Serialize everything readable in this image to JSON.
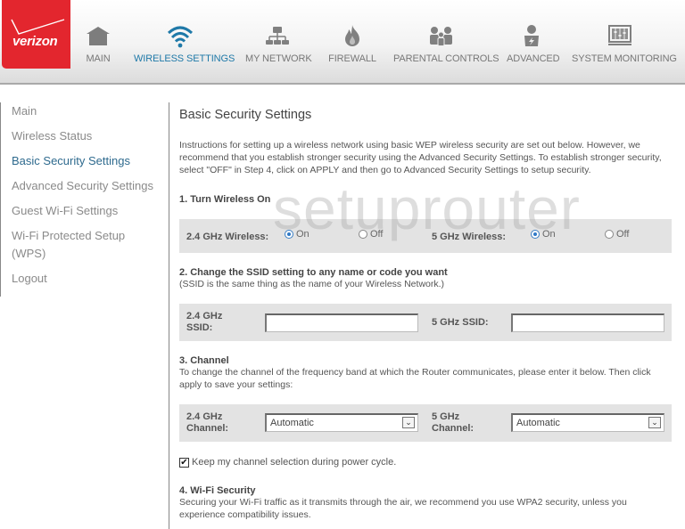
{
  "brand": {
    "logo_text": "verizon",
    "color": "#e3262e",
    "accent": "#1f79a8"
  },
  "nav": {
    "items": [
      {
        "label": "MAIN",
        "icon": "home-icon",
        "active": false
      },
      {
        "label": "WIRELESS SETTINGS",
        "icon": "wifi-icon",
        "active": true
      },
      {
        "label": "MY NETWORK",
        "icon": "network-icon",
        "active": false
      },
      {
        "label": "FIREWALL",
        "icon": "flame-icon",
        "active": false
      },
      {
        "label": "PARENTAL CONTROLS",
        "icon": "family-icon",
        "active": false
      },
      {
        "label": "ADVANCED",
        "icon": "advanced-user-icon",
        "active": false
      },
      {
        "label": "SYSTEM MONITORING",
        "icon": "monitor-icon",
        "active": false
      }
    ]
  },
  "sidebar": {
    "items": [
      {
        "label": "Main"
      },
      {
        "label": "Wireless Status"
      },
      {
        "label": "Basic Security Settings",
        "active": true
      },
      {
        "label": "Advanced Security Settings"
      },
      {
        "label": "Guest Wi-Fi Settings"
      },
      {
        "label": "Wi-Fi Protected Setup"
      },
      {
        "label": "(WPS)"
      },
      {
        "label": "Logout"
      }
    ]
  },
  "watermark": "setuprouter",
  "main": {
    "title": "Basic Security Settings",
    "intro": "Instructions for setting up a wireless network using basic WEP wireless security are set out below. However, we recommend that you establish stronger security using the Advanced Security Settings. To establish stronger security, select \"OFF\" in Step 4, click on APPLY and then go to Advanced Security Settings to setup security.",
    "step1": {
      "heading": "1. Turn Wireless On",
      "label_24": "2.4 GHz Wireless:",
      "label_5": "5 GHz Wireless:",
      "on": "On",
      "off": "Off",
      "value_24": "On",
      "value_5": "On"
    },
    "step2": {
      "heading": "2. Change the SSID setting to any name or code you want",
      "desc": "(SSID is the same thing as the name of your Wireless Network.)",
      "label_24_line1": "2.4 GHz",
      "label_24_line2": "SSID:",
      "label_5": "5 GHz SSID:",
      "value_24": "",
      "value_5": ""
    },
    "step3": {
      "heading": "3. Channel",
      "desc": "To change the channel of the frequency band at which the Router communicates, please enter it below. Then click apply to save your settings:",
      "label_24_line1": "2.4 GHz",
      "label_24_line2": "Channel:",
      "label_5_line1": "5 GHz",
      "label_5_line2": "Channel:",
      "value_24": "Automatic",
      "value_5": "Automatic",
      "keep_label": "Keep my channel selection during power cycle.",
      "keep_checked": true,
      "check_glyph": "✔",
      "arrow_glyph": "⌄"
    },
    "step4": {
      "heading": "4. Wi-Fi Security",
      "desc": "Securing your Wi-Fi traffic as it transmits through the air, we recommend you use WPA2 security, unless you experience compatibility issues."
    }
  }
}
